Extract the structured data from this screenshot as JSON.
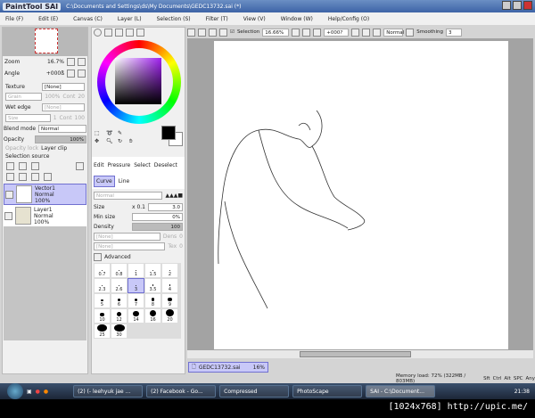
{
  "window": {
    "app_logo": "PaintTool SAI",
    "title": "C:\\Documents and Settings\\ds\\My Documents\\GEDC13732.sai (*)"
  },
  "menu": [
    "File (F)",
    "Edit (E)",
    "Canvas (C)",
    "Layer (L)",
    "Selection (S)",
    "Filter (T)",
    "View (V)",
    "Window (W)",
    "Help/Config (O)"
  ],
  "navigator": {
    "zoom_label": "Zoom",
    "zoom_value": "16.7%",
    "angle_label": "Angle",
    "angle_value": "+000ß"
  },
  "texture": {
    "label": "Texture",
    "value": "[None]",
    "grain_label": "Grain",
    "grain_value": "100%",
    "cont_label": "Cont",
    "cont_value": "20"
  },
  "wet_edge": {
    "label": "Wet edge",
    "value": "[None]",
    "size_label": "Size",
    "size_value": "1",
    "cont_label": "Cont",
    "cont_value": "100"
  },
  "blend": {
    "label": "Blend mode",
    "value": "Normal",
    "opacity_label": "Opacity",
    "opacity_value": "100%",
    "opacity_lock": "Opacity lock",
    "layer_clip": "Layer clip",
    "selection_source": "Selection source"
  },
  "layers": [
    {
      "name": "Vector1",
      "mode": "Normal",
      "opacity": "100%",
      "selected": true
    },
    {
      "name": "Layer1",
      "mode": "Normal",
      "opacity": "100%",
      "selected": false
    }
  ],
  "tools": {
    "groups": [
      "Edit",
      "Pressure",
      "Select",
      "Deselect"
    ],
    "pens": [
      "Curve",
      "Line"
    ]
  },
  "brush": {
    "mode": "Normal",
    "size_label": "Size",
    "size_mult": "x 0.1",
    "size_value": "3.0",
    "minsize_label": "Min size",
    "minsize_value": "0%",
    "density_label": "Density",
    "density_value": "100",
    "shape1": "[None]",
    "shape2": "[None]",
    "dens_label": "Dens",
    "dens_value": "0",
    "tex_label": "Tex",
    "tex_value": "0",
    "advanced": "Advanced",
    "sizes": [
      "0.7",
      "0.8",
      "1",
      "1.5",
      "2",
      "2.3",
      "2.6",
      "3",
      "3.5",
      "4",
      "5",
      "6",
      "7",
      "8",
      "9",
      "10",
      "12",
      "14",
      "16",
      "20",
      "25",
      "30"
    ],
    "selected_size": "3"
  },
  "canvas_toolbar": {
    "selection": "Selection",
    "zoom": "16.66%",
    "angle": "+000?",
    "blend": "Normal",
    "smoothing_label": "Smoothing",
    "smoothing_value": "3"
  },
  "file_tab": {
    "name": "GEDC13732.sai",
    "zoom": "16%"
  },
  "status": {
    "memory": "Memory load: 72% (322MB / 803MB)",
    "keys": [
      "Sft",
      "Ctrl",
      "Alt",
      "SPC",
      "Any"
    ]
  },
  "taskbar": {
    "tasks": [
      "(2) (- leehyuk jae ...",
      "(2) Facebook - Go...",
      "Compressed",
      "PhotoScape",
      "SAI - C:\\Document..."
    ],
    "active": 4,
    "time": "21:38"
  },
  "watermark": "[1024x768] http://upic.me/",
  "colors": {
    "accent": "#c8c8f8",
    "title_bar": "#4a6fae",
    "primary_color": "#000000",
    "secondary_color": "#ffffff"
  }
}
